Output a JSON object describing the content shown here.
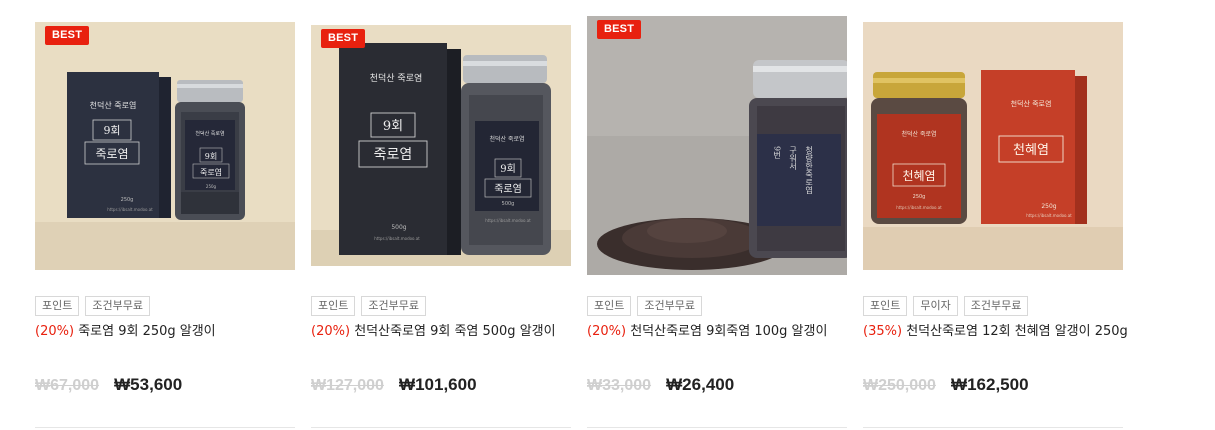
{
  "products": [
    {
      "badge": "BEST",
      "tags": [
        "포인트",
        "조건부무료"
      ],
      "discount": "(20%)",
      "name": "죽로염 9회 250g 알갱이",
      "original_price": "₩67,000",
      "sale_price": "₩53,600",
      "box_label_1": "9회",
      "box_label_2": "죽로염",
      "box_weight": "250g",
      "jar_label_1": "9회",
      "jar_label_2": "죽로염",
      "jar_weight": "250g",
      "url": "https://ibsalt.modoo.at"
    },
    {
      "badge": "BEST",
      "tags": [
        "포인트",
        "조건부무료"
      ],
      "discount": "(20%)",
      "name": "천덕산죽로염 9회 죽염 500g 알갱이",
      "original_price": "₩127,000",
      "sale_price": "₩101,600",
      "box_label_1": "9회",
      "box_label_2": "죽로염",
      "box_weight": "500g",
      "jar_label_1": "9회",
      "jar_label_2": "죽로염",
      "jar_weight": "500g",
      "url": "https://ibsalt.modoo.at"
    },
    {
      "badge": "BEST",
      "tags": [
        "포인트",
        "조건부무료"
      ],
      "discount": "(20%)",
      "name": "천덕산죽로염 9회죽염 100g 알갱이",
      "original_price": "₩33,000",
      "sale_price": "₩26,400",
      "jar_col_1": "9번",
      "jar_col_2": "구워서",
      "jar_col_3": "청량한죽로염"
    },
    {
      "badge": "",
      "tags": [
        "포인트",
        "무이자",
        "조건부무료"
      ],
      "discount": "(35%)",
      "name": "천덕산죽로염 12회 천혜염 알갱이 250g",
      "original_price": "₩250,000",
      "sale_price": "₩162,500",
      "box_label_1": "천혜염",
      "box_weight": "250g",
      "jar_label_1": "천혜염",
      "jar_weight": "250g",
      "url": "https://ibsalt.modoo.at"
    }
  ],
  "colors": {
    "badge": "#e8210f",
    "discount": "#e8210f",
    "strike_price": "#cfcfcf",
    "sale_price": "#222222",
    "tag_border": "#d8d8d8"
  }
}
